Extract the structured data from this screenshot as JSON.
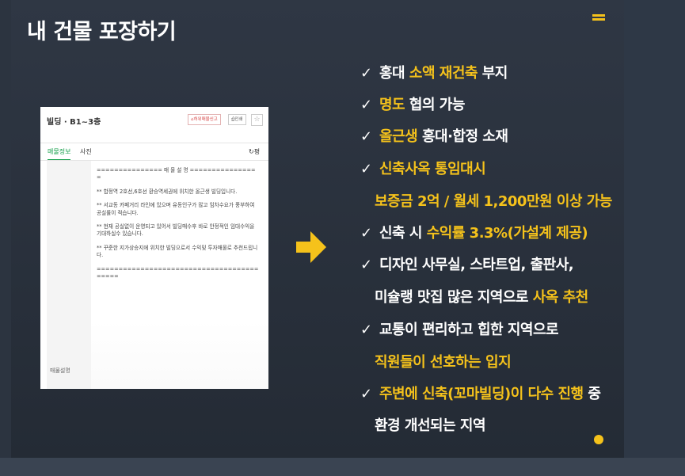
{
  "page_title": "내 건물 포장하기",
  "colors": {
    "background": "#2c3440",
    "accent": "#f5c21b",
    "text": "#ffffff"
  },
  "listing": {
    "heading": "빌딩 · B1~3층",
    "report_button": "허위매물신고",
    "print_button": "인쇄",
    "favorite_icon": "star-icon",
    "tab_info": "매물정보",
    "tab_photo": "사진",
    "tab_extra": "평",
    "side_label": "매물설명",
    "separator_top": "=============== 매 물 설 명 ===============",
    "separator_top_tail": "=",
    "paragraphs": [
      "** 합정역 2호선,6호선 환승역세권에 위치한 올근생 빌딩입니다.",
      "** 서교동 카페거리 라인에 있으며 유동인구가 많고 임차수요가 풍부하여 공실률이 적습니다.",
      "** 현재 공실없이 운영되고 있어서 빌딩매수후 바로 안정적인 임대수익을 기대하실수 있습니다.",
      "** 꾸준한 지가상승지에 위치한 빌딩으로서 수익및 투자매물로 추천드립니다."
    ],
    "separator_bottom": "=====================================",
    "separator_bottom_tail": "====="
  },
  "bullets": {
    "check_mark": "✓",
    "b1": {
      "a": "홍대 ",
      "hl": "소액 재건축",
      "b": " 부지"
    },
    "b2": {
      "hl": "명도",
      "b": " 협의 가능"
    },
    "b3": {
      "hl": "올근생",
      "b": " 홍대·합정 소재"
    },
    "b4": {
      "hl": "신축사옥 통임대시"
    },
    "b4c": {
      "hl": "보증금 2억 / 월세 1,200만원 이상 가능"
    },
    "b5": {
      "a": "신축 시 ",
      "hl": "수익률 3.3%(가설계 제공)"
    },
    "b6": {
      "a": "디자인 사무실, 스타트업, 출판사,"
    },
    "b6c": {
      "a": "미슐랭 맛집 많은 지역으로 ",
      "hl": "사옥 추천"
    },
    "b7": {
      "a": "교통이 편리하고 힙한 지역으로"
    },
    "b7c": {
      "hl": "직원들이 선호하는 입지"
    },
    "b8": {
      "hl": "주변에 신축(꼬마빌딩)이 다수 진행",
      "b": " 중"
    },
    "b8c": {
      "a": "환경 개선되는 지역"
    }
  }
}
